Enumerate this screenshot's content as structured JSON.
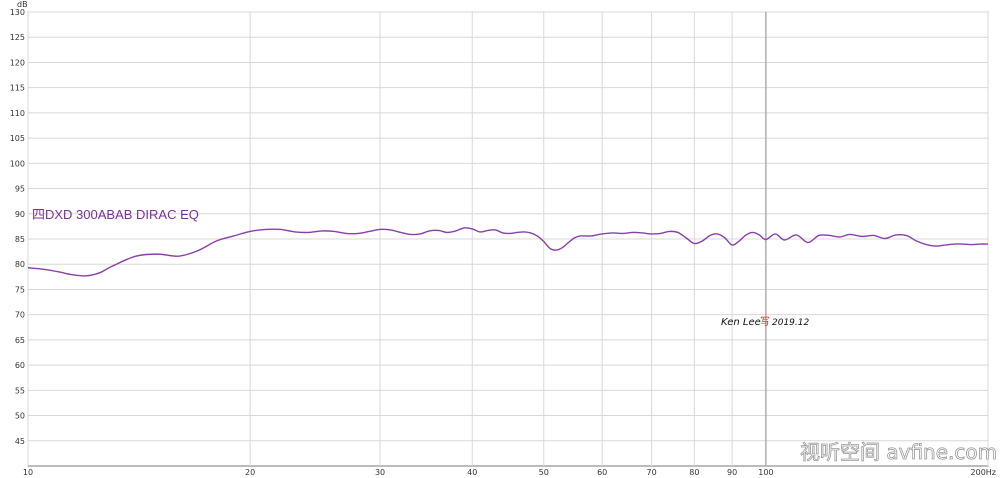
{
  "chart_data": {
    "type": "line",
    "x_scale": "log",
    "xlim": [
      10,
      200
    ],
    "ylim": [
      40,
      130
    ],
    "xticks": [
      {
        "v": 10,
        "label": "10"
      },
      {
        "v": 20,
        "label": "20"
      },
      {
        "v": 30,
        "label": "30"
      },
      {
        "v": 40,
        "label": "40"
      },
      {
        "v": 50,
        "label": "50"
      },
      {
        "v": 60,
        "label": "60"
      },
      {
        "v": 70,
        "label": "70"
      },
      {
        "v": 80,
        "label": "80"
      },
      {
        "v": 90,
        "label": "90"
      },
      {
        "v": 100,
        "label": "100"
      },
      {
        "v": 200,
        "label": "200Hz"
      }
    ],
    "yticks": [
      45,
      50,
      55,
      60,
      65,
      70,
      75,
      80,
      85,
      90,
      95,
      100,
      105,
      110,
      115,
      120,
      125,
      130
    ],
    "y_unit": "dB",
    "grid": true,
    "line_color": "#8a3fa8",
    "series": [
      {
        "name": "四DXD 300ABAB DIRAC EQ",
        "x": [
          10,
          10.5,
          11,
          11.5,
          12,
          12.5,
          13,
          14,
          15,
          16,
          17,
          18,
          19,
          20,
          21,
          22,
          23,
          24,
          25,
          26,
          27,
          28,
          29,
          30,
          31,
          32,
          33,
          34,
          35,
          36,
          37,
          38,
          39,
          40,
          41,
          42,
          43,
          44,
          45,
          46,
          47,
          48,
          49,
          50,
          51,
          52,
          53,
          54,
          55,
          56,
          57,
          58,
          59,
          60,
          62,
          64,
          66,
          68,
          70,
          72,
          74,
          76,
          78,
          80,
          82,
          84,
          86,
          88,
          90,
          92,
          94,
          96,
          98,
          100,
          103,
          106,
          110,
          114,
          118,
          122,
          126,
          130,
          135,
          140,
          145,
          150,
          155,
          160,
          165,
          170,
          175,
          180,
          185,
          190,
          195,
          200
        ],
        "y": [
          79.3,
          79.0,
          78.5,
          77.9,
          77.7,
          78.3,
          79.6,
          81.6,
          82.0,
          81.6,
          82.7,
          84.6,
          85.6,
          86.5,
          86.9,
          86.9,
          86.4,
          86.3,
          86.6,
          86.5,
          86.1,
          86.1,
          86.5,
          86.9,
          86.8,
          86.3,
          85.9,
          86.0,
          86.6,
          86.7,
          86.3,
          86.6,
          87.2,
          87.0,
          86.4,
          86.7,
          86.8,
          86.2,
          86.1,
          86.3,
          86.4,
          86.2,
          85.6,
          84.5,
          83.1,
          82.8,
          83.3,
          84.3,
          85.2,
          85.6,
          85.6,
          85.6,
          85.8,
          86.0,
          86.2,
          86.1,
          86.3,
          86.2,
          86.0,
          86.1,
          86.5,
          86.3,
          85.2,
          84.1,
          84.6,
          85.7,
          86.0,
          85.2,
          83.8,
          84.6,
          85.8,
          86.3,
          85.8,
          84.9,
          86.0,
          84.8,
          85.8,
          84.3,
          85.7,
          85.7,
          85.4,
          85.9,
          85.5,
          85.7,
          85.1,
          85.8,
          85.7,
          84.6,
          83.9,
          83.6,
          83.8,
          84.0,
          84.0,
          83.9,
          84.0,
          84.0
        ]
      }
    ],
    "annotation_signature": {
      "name": "Ken Lee",
      "mark": "写",
      "date": "2019.12"
    },
    "watermark": "视听空间 avfine.com"
  }
}
